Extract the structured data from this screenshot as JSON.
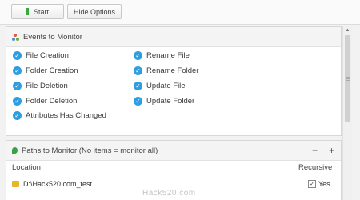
{
  "toolbar": {
    "start_label": "Start",
    "hide_label": "Hide Options"
  },
  "events": {
    "title": "Events to Monitor",
    "items": [
      {
        "label": "File Creation",
        "checked": true
      },
      {
        "label": "Folder Creation",
        "checked": true
      },
      {
        "label": "File Deletion",
        "checked": true
      },
      {
        "label": "Folder Deletion",
        "checked": true
      },
      {
        "label": "Attributes Has Changed",
        "checked": true
      },
      {
        "label": "Rename File",
        "checked": true
      },
      {
        "label": "Rename Folder",
        "checked": true
      },
      {
        "label": "Update File",
        "checked": true
      },
      {
        "label": "Update Folder",
        "checked": true
      }
    ]
  },
  "paths": {
    "title": "Paths to Monitor (No items = monitor all)",
    "minus": "−",
    "plus": "+",
    "columns": {
      "location": "Location",
      "recursive": "Recursive"
    },
    "rows": [
      {
        "location": "D:\\Hack520.com_test",
        "recursive": "Yes",
        "recursive_checked": true
      }
    ]
  },
  "watermark": "Hack520.com"
}
